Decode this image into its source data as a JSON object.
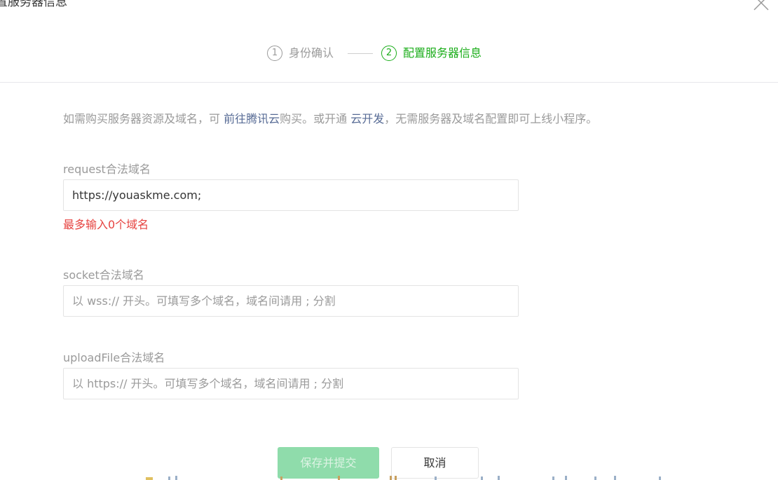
{
  "dialog": {
    "title": "置服务器信息",
    "close_icon": "close-icon"
  },
  "steps": [
    {
      "number": "1",
      "label": "身份确认",
      "active": false
    },
    {
      "number": "2",
      "label": "配置服务器信息",
      "active": true
    }
  ],
  "notice": {
    "text_1": "如需购买服务器资源及域名，可 ",
    "link_1": "前往腾讯云",
    "text_2": "购买。或开通 ",
    "link_2": "云开发",
    "text_3": "，无需服务器及域名配置即可上线小程序。"
  },
  "fields": {
    "request": {
      "label": "request合法域名",
      "value": "https://youaskme.com;",
      "error": "最多输入0个域名"
    },
    "socket": {
      "label": "socket合法域名",
      "placeholder": "以 wss:// 开头。可填写多个域名，域名间请用 ; 分割"
    },
    "upload": {
      "label": "uploadFile合法域名",
      "placeholder": "以 https:// 开头。可填写多个域名，域名间请用 ; 分割"
    }
  },
  "buttons": {
    "submit_label": "保存并提交",
    "cancel_label": "取消"
  },
  "colors": {
    "accent": "#1aad19",
    "link": "#576b95",
    "error": "#e64340",
    "muted": "#9a9a9a",
    "primary_disabled_bg": "#8fdcab"
  }
}
